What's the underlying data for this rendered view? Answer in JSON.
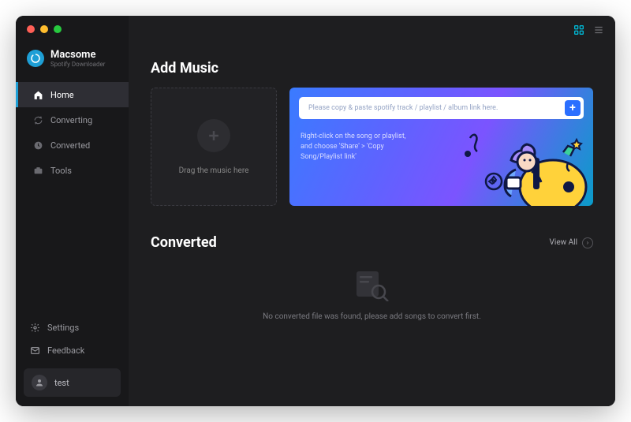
{
  "brand": {
    "name": "Macsome",
    "subtitle": "Spotify Downloader"
  },
  "nav": {
    "home": "Home",
    "converting": "Converting",
    "converted": "Converted",
    "tools": "Tools"
  },
  "footer": {
    "settings": "Settings",
    "feedback": "Feedback"
  },
  "user": {
    "name": "test"
  },
  "add_music": {
    "title": "Add Music",
    "drop_label": "Drag the music here",
    "paste_placeholder": "Please copy & paste spotify track / playlist / album link here.",
    "tip": "Right-click on the song or playlist, and choose 'Share' > 'Copy Song/Playlist link'"
  },
  "converted_section": {
    "title": "Converted",
    "view_all": "View All",
    "empty_msg": "No converted file was found, please add songs to convert first."
  }
}
